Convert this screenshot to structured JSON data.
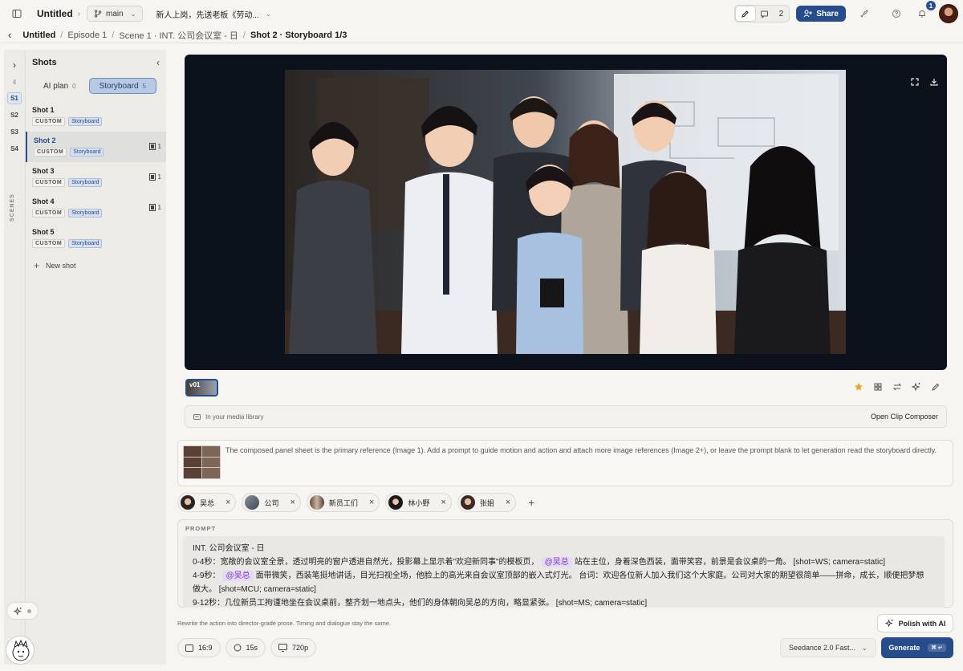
{
  "topbar": {
    "project_title": "Untitled",
    "branch": "main",
    "doc_title": "新人上岗，先送老板《劳动...",
    "comment_count": "2",
    "share_label": "Share",
    "notification_count": "1"
  },
  "breadcrumb": {
    "items": [
      "Untitled",
      "Episode 1",
      "Scene 1 · INT. 公司会议室 - 日",
      "Shot 2 · Storyboard 1/3"
    ]
  },
  "rail": {
    "count": "4",
    "scenes": [
      "S1",
      "S2",
      "S3",
      "S4"
    ],
    "label": "SCENES"
  },
  "shots_panel": {
    "title": "Shots",
    "tabs": [
      {
        "label": "AI plan",
        "count": "0"
      },
      {
        "label": "Storyboard",
        "count": "5"
      }
    ],
    "shots": [
      {
        "name": "Shot 1",
        "tag1": "CUSTOM",
        "tag2": "Storyboard",
        "count": ""
      },
      {
        "name": "Shot 2",
        "tag1": "CUSTOM",
        "tag2": "Storyboard",
        "count": "1"
      },
      {
        "name": "Shot 3",
        "tag1": "CUSTOM",
        "tag2": "Storyboard",
        "count": "1"
      },
      {
        "name": "Shot 4",
        "tag1": "CUSTOM",
        "tag2": "Storyboard",
        "count": "1"
      },
      {
        "name": "Shot 5",
        "tag1": "CUSTOM",
        "tag2": "Storyboard",
        "count": ""
      }
    ],
    "new_shot": "New shot"
  },
  "viewer": {
    "version_label": "v01"
  },
  "media_bar": {
    "left": "In your media library",
    "right": "Open Clip Composer"
  },
  "panel_note": "The composed panel sheet is the primary reference (Image 1). Add a prompt to guide motion and action and attach more image references (Image 2+), or leave the prompt blank to let generation read the storyboard directly.",
  "chips": [
    {
      "name": "吴总",
      "color": "#2b2420"
    },
    {
      "name": "公司",
      "color": "#55606b"
    },
    {
      "name": "新员工们",
      "color": "#6a4a3a"
    },
    {
      "name": "林小野",
      "color": "#1e1a1c"
    },
    {
      "name": "张姐",
      "color": "#3a2a28"
    }
  ],
  "prompt": {
    "label": "PROMPT",
    "line1": "INT. 公司会议室 - 日",
    "line2a": "0-4秒：宽敞的会议室全景，透过明亮的窗户透进自然光，投影幕上显示着\"欢迎新同事\"的模板页，",
    "line2_mention": "@吴总",
    "line2b": "站在主位，身着深色西装，面带笑容，前景是会议桌的一角。 [shot=WS; camera=static]",
    "line3a": "4-9秒：",
    "line3_mention": "@吴总",
    "line3b": "面带微笑，西装笔挺地讲话，目光扫视全场，他脸上的高光来自会议室顶部的嵌入式灯光。 台词：欢迎各位新人加入我们这个大家庭。公司对大家的期望很简单——拼命，成长，顺便把梦想",
    "line4": "做大。 [shot=MCU; camera=static]",
    "line5": "9-12秒：几位新员工拘谨地坐在会议桌前，整齐划一地点头，他们的身体朝向吴总的方向，略显紧张。 [shot=MS; camera=static]"
  },
  "hint": "Rewrite the action into director-grade prose. Timing and dialogue stay the same.",
  "polish_label": "Polish with AI",
  "settings": {
    "aspect": "16:9",
    "duration": "15s",
    "resolution": "720p"
  },
  "model": "Seedance 2.0 Fast...",
  "generate": {
    "label": "Generate",
    "shortcut": "⌘ ↵"
  },
  "colors": {
    "accent": "#264c8c",
    "mention_bg": "#e6d9f5",
    "star": "#f0a020"
  }
}
